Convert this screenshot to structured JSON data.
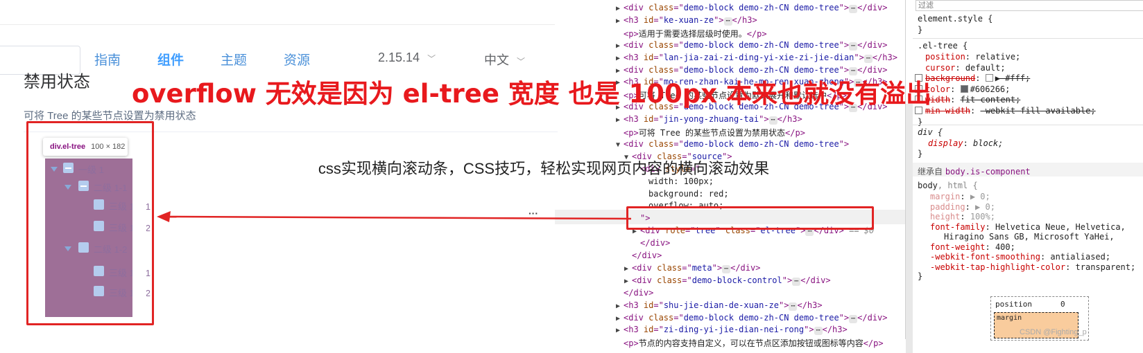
{
  "left": {
    "nav": [
      "指南",
      "组件",
      "主题",
      "资源"
    ],
    "nav_active_index": 1,
    "version": "2.15.14",
    "version_caret": "﹀",
    "language": "中文",
    "section_title": "禁用状态",
    "section_desc": "可将 Tree 的某些节点设置为禁用状态",
    "tooltip_tag": "div.el-tree",
    "tooltip_size": "100 × 182",
    "tree_labels": [
      "一级 1",
      "二级 1-1",
      "三级 1-1-1",
      "三级 1-1-2",
      "二级 1-2",
      "三级 1-2-1",
      "三级 1-2-2"
    ]
  },
  "annotation": "overflow 无效是因为 el-tree 宽度 也是 100px 本来也就没有溢出",
  "caption": "css实现横向滚动条，CSS技巧，轻松实现网页内容的横向滚动效果",
  "elements": {
    "lines": [
      {
        "indent": 0,
        "tri": "▶",
        "parts": [
          [
            "tg",
            "<div "
          ],
          [
            "an",
            "class"
          ],
          [
            "tg",
            "=\""
          ],
          [
            "av",
            "demo-block demo-zh-CN demo-tree"
          ],
          [
            "tg",
            "\">"
          ],
          [
            "pill",
            "⋯"
          ],
          [
            "tg",
            "</div>"
          ]
        ]
      },
      {
        "indent": 0,
        "tri": "▶",
        "parts": [
          [
            "tg",
            "<h3 "
          ],
          [
            "an",
            "id"
          ],
          [
            "tg",
            "=\""
          ],
          [
            "av",
            "ke-xuan-ze"
          ],
          [
            "tg",
            "\">"
          ],
          [
            "pill",
            "⋯"
          ],
          [
            "tg",
            "</h3>"
          ]
        ]
      },
      {
        "indent": 0,
        "tri": "",
        "parts": [
          [
            "tg",
            "<p>"
          ],
          [
            "tx",
            "适用于需要选择层级时使用。"
          ],
          [
            "tg",
            "</p>"
          ]
        ]
      },
      {
        "indent": 0,
        "tri": "▶",
        "parts": [
          [
            "tg",
            "<div "
          ],
          [
            "an",
            "class"
          ],
          [
            "tg",
            "=\""
          ],
          [
            "av",
            "demo-block demo-zh-CN demo-tree"
          ],
          [
            "tg",
            "\">"
          ],
          [
            "pill",
            "⋯"
          ],
          [
            "tg",
            "</div>"
          ]
        ]
      },
      {
        "indent": 0,
        "tri": "▶",
        "parts": [
          [
            "tg",
            "<h3 "
          ],
          [
            "an",
            "id"
          ],
          [
            "tg",
            "=\""
          ],
          [
            "av",
            "lan-jia-zai-zi-ding-yi-xie-zi-jie-dian"
          ],
          [
            "tg",
            "\">"
          ],
          [
            "pill",
            "⋯"
          ],
          [
            "tg",
            "</h3>"
          ]
        ]
      },
      {
        "indent": 0,
        "tri": "▶",
        "parts": [
          [
            "tg",
            "<div "
          ],
          [
            "an",
            "class"
          ],
          [
            "tg",
            "=\""
          ],
          [
            "av",
            "demo-block demo-zh-CN demo-tree"
          ],
          [
            "tg",
            "\">"
          ],
          [
            "pill",
            "⋯"
          ],
          [
            "tg",
            "</div>"
          ]
        ]
      },
      {
        "indent": 0,
        "tri": "▶",
        "parts": [
          [
            "tg",
            "<h3 "
          ],
          [
            "an",
            "id"
          ],
          [
            "tg",
            "=\""
          ],
          [
            "av",
            "mo-ren-zhan-kai-he-mo-ren-xuan-zhong"
          ],
          [
            "tg",
            "\">"
          ],
          [
            "pill",
            "⋯"
          ],
          [
            "tg",
            "</h3>"
          ]
        ]
      },
      {
        "indent": 0,
        "tri": "",
        "parts": [
          [
            "tg",
            "<p>"
          ],
          [
            "tx",
            "可将 Tree 的某些节点设置为默认展开和默认选中"
          ],
          [
            "tg",
            "</p>"
          ]
        ]
      },
      {
        "indent": 0,
        "tri": "▶",
        "parts": [
          [
            "tg",
            "<div "
          ],
          [
            "an",
            "class"
          ],
          [
            "tg",
            "=\""
          ],
          [
            "av",
            "demo-block demo-zh-CN demo-tree"
          ],
          [
            "tg",
            "\">"
          ],
          [
            "pill",
            "⋯"
          ],
          [
            "tg",
            "</div>"
          ]
        ]
      },
      {
        "indent": 0,
        "tri": "▶",
        "parts": [
          [
            "tg",
            "<h3 "
          ],
          [
            "an",
            "id"
          ],
          [
            "tg",
            "=\""
          ],
          [
            "av",
            "jin-yong-zhuang-tai"
          ],
          [
            "tg",
            "\">"
          ],
          [
            "pill",
            "⋯"
          ],
          [
            "tg",
            "</h3>"
          ]
        ]
      },
      {
        "indent": 0,
        "tri": "",
        "parts": [
          [
            "tg",
            "<p>"
          ],
          [
            "tx",
            "可将 Tree 的某些节点设置为禁用状态"
          ],
          [
            "tg",
            "</p>"
          ]
        ]
      },
      {
        "indent": 0,
        "tri": "▼",
        "parts": [
          [
            "tg",
            "<div "
          ],
          [
            "an",
            "class"
          ],
          [
            "tg",
            "=\""
          ],
          [
            "av",
            "demo-block demo-zh-CN demo-tree"
          ],
          [
            "tg",
            "\">"
          ]
        ]
      },
      {
        "indent": 1,
        "tri": "▼",
        "parts": [
          [
            "tg",
            "<div "
          ],
          [
            "an",
            "class"
          ],
          [
            "tg",
            "=\""
          ],
          [
            "av",
            "source"
          ],
          [
            "tg",
            "\">"
          ]
        ]
      },
      {
        "indent": 2,
        "tri": "",
        "parts": [
          [
            "tg",
            "<div "
          ],
          [
            "an",
            "style"
          ],
          [
            "tg",
            "=\""
          ]
        ]
      },
      {
        "indent": 3,
        "tri": "",
        "parts": [
          [
            "tx",
            "width: 100px;"
          ]
        ]
      },
      {
        "indent": 3,
        "tri": "",
        "parts": [
          [
            "tx",
            "background: red;"
          ]
        ]
      },
      {
        "indent": 3,
        "tri": "",
        "parts": [
          [
            "tx",
            "overflow: auto;"
          ]
        ]
      },
      {
        "indent": 2,
        "tri": "",
        "parts": [
          [
            "tg",
            "\">"
          ]
        ]
      },
      {
        "indent": 2,
        "tri": "▶",
        "parts": [
          [
            "tg",
            "<div "
          ],
          [
            "an",
            "role"
          ],
          [
            "tg",
            "=\""
          ],
          [
            "av",
            "tree"
          ],
          [
            "tg",
            "\" "
          ],
          [
            "an",
            "class"
          ],
          [
            "tg",
            "=\""
          ],
          [
            "av",
            "el-tree"
          ],
          [
            "tg",
            "\">"
          ],
          [
            "pill",
            "⋯"
          ],
          [
            "tg",
            "</div>"
          ],
          [
            "eqs",
            " == $0"
          ]
        ]
      },
      {
        "indent": 2,
        "tri": "",
        "parts": [
          [
            "tg",
            "</div>"
          ]
        ]
      },
      {
        "indent": 1,
        "tri": "",
        "parts": [
          [
            "tg",
            "</div>"
          ]
        ]
      },
      {
        "indent": 1,
        "tri": "▶",
        "parts": [
          [
            "tg",
            "<div "
          ],
          [
            "an",
            "class"
          ],
          [
            "tg",
            "=\""
          ],
          [
            "av",
            "meta"
          ],
          [
            "tg",
            "\">"
          ],
          [
            "pill",
            "⋯"
          ],
          [
            "tg",
            "</div>"
          ]
        ]
      },
      {
        "indent": 1,
        "tri": "▶",
        "parts": [
          [
            "tg",
            "<div "
          ],
          [
            "an",
            "class"
          ],
          [
            "tg",
            "=\""
          ],
          [
            "av",
            "demo-block-control"
          ],
          [
            "tg",
            "\">"
          ],
          [
            "pill",
            "⋯"
          ],
          [
            "tg",
            "</div>"
          ]
        ]
      },
      {
        "indent": 0,
        "tri": "",
        "parts": [
          [
            "tg",
            "</div>"
          ]
        ]
      },
      {
        "indent": 0,
        "tri": "▶",
        "parts": [
          [
            "tg",
            "<h3 "
          ],
          [
            "an",
            "id"
          ],
          [
            "tg",
            "=\""
          ],
          [
            "av",
            "shu-jie-dian-de-xuan-ze"
          ],
          [
            "tg",
            "\">"
          ],
          [
            "pill",
            "⋯"
          ],
          [
            "tg",
            "</h3>"
          ]
        ]
      },
      {
        "indent": 0,
        "tri": "▶",
        "parts": [
          [
            "tg",
            "<div "
          ],
          [
            "an",
            "class"
          ],
          [
            "tg",
            "=\""
          ],
          [
            "av",
            "demo-block demo-zh-CN demo-tree"
          ],
          [
            "tg",
            "\">"
          ],
          [
            "pill",
            "⋯"
          ],
          [
            "tg",
            "</div>"
          ]
        ]
      },
      {
        "indent": 0,
        "tri": "▶",
        "parts": [
          [
            "tg",
            "<h3 "
          ],
          [
            "an",
            "id"
          ],
          [
            "tg",
            "=\""
          ],
          [
            "av",
            "zi-ding-yi-jie-dian-nei-rong"
          ],
          [
            "tg",
            "\">"
          ],
          [
            "pill",
            "⋯"
          ],
          [
            "tg",
            "</h3>"
          ]
        ]
      },
      {
        "indent": 0,
        "tri": "",
        "parts": [
          [
            "tg",
            "<p>"
          ],
          [
            "tx",
            "节点的内容支持自定义，可以在节点区添加按钮或图标等内容"
          ],
          [
            "tg",
            "</p>"
          ]
        ]
      }
    ]
  },
  "styles": {
    "filter": "过滤",
    "element_style": "element.style {",
    "el_tree_selector": ".el-tree {",
    "el_tree_props": [
      {
        "name": "position",
        "value": "relative;",
        "struck": false,
        "check": false,
        "swatch": ""
      },
      {
        "name": "cursor",
        "value": "default;",
        "struck": false,
        "check": false,
        "swatch": ""
      },
      {
        "name": "background",
        "value": "▶ #fff;",
        "struck": true,
        "check": true,
        "swatch": "#ffffff"
      },
      {
        "name": "color",
        "value": "#606266;",
        "struck": false,
        "check": true,
        "swatch": "#606266"
      },
      {
        "name": "width",
        "value": "fit-content;",
        "struck": true,
        "check": true,
        "swatch": ""
      },
      {
        "name": "min-width",
        "value": "-webkit-fill-available;",
        "struck": true,
        "check": true,
        "swatch": ""
      }
    ],
    "div_selector": "div {",
    "div_prop": {
      "name": "display",
      "value": "block;"
    },
    "inherited_label": "继承自",
    "inherited_from": "body.is-component",
    "body_selector": "body",
    "body_selector_rest": ", html {",
    "body_props": [
      {
        "name": "margin",
        "value": "▶ 0;",
        "faded": true
      },
      {
        "name": "padding",
        "value": "▶ 0;",
        "faded": true
      },
      {
        "name": "height",
        "value": "100%;",
        "faded": true
      },
      {
        "name": "font-family",
        "value": "Helvetica Neue, Helvetica,",
        "faded": false
      },
      {
        "name": "",
        "value": "Hiragino Sans GB, Microsoft YaHei,",
        "faded": false
      },
      {
        "name": "font-weight",
        "value": "400;",
        "faded": false
      },
      {
        "name": "-webkit-font-smoothing",
        "value": "antialiased;",
        "faded": false
      },
      {
        "name": "-webkit-tap-highlight-color",
        "value": "transparent;",
        "faded": false
      }
    ],
    "close_brace": "}",
    "boxmodel_position": "position",
    "boxmodel_zero": "0",
    "boxmodel_margin": "margin",
    "watermark": "CSDN @Fighting_p"
  },
  "colors": {
    "accent": "#409eff",
    "annotation_red": "#e8191d",
    "tree_highlight": "#9e6f97",
    "devtools_tag": "#881280",
    "devtools_attr": "#994500",
    "devtools_value": "#1a1aa6"
  }
}
